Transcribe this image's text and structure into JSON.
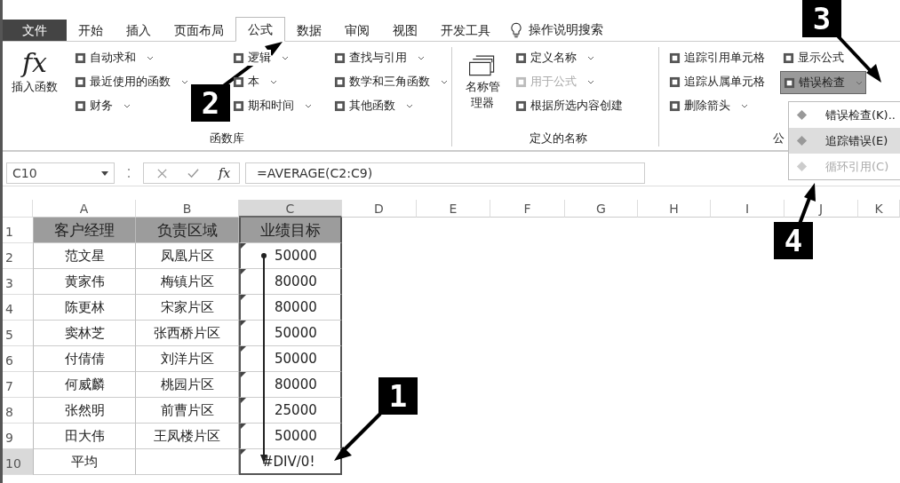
{
  "tabs": [
    {
      "label": "文件",
      "kind": "file",
      "selected": false
    },
    {
      "label": "开始",
      "kind": "tab",
      "selected": false
    },
    {
      "label": "插入",
      "kind": "tab",
      "selected": false
    },
    {
      "label": "页面布局",
      "kind": "tab",
      "selected": false
    },
    {
      "label": "公式",
      "kind": "tab",
      "selected": true
    },
    {
      "label": "数据",
      "kind": "tab",
      "selected": false
    },
    {
      "label": "审阅",
      "kind": "tab",
      "selected": false
    },
    {
      "label": "视图",
      "kind": "tab",
      "selected": false
    },
    {
      "label": "开发工具",
      "kind": "tab",
      "selected": false
    }
  ],
  "tell_me": "操作说明搜索",
  "ribbon": {
    "groups": [
      {
        "label": "函数库",
        "big_button": {
          "icon_text": "fx",
          "label": "插入函数"
        },
        "columns": [
          [
            {
              "label": "自动求和",
              "dropdown": true,
              "disabled": false,
              "selected": false
            },
            {
              "label": "最近使用的函数",
              "dropdown": true,
              "disabled": false,
              "selected": false
            },
            {
              "label": "财务",
              "dropdown": true,
              "disabled": false,
              "selected": false
            }
          ],
          [
            {
              "label": "逻辑",
              "dropdown": true,
              "disabled": false,
              "selected": false
            },
            {
              "label": "本",
              "dropdown": true,
              "disabled": false,
              "selected": false
            },
            {
              "label": "期和时间",
              "dropdown": true,
              "disabled": false,
              "selected": false
            }
          ],
          [
            {
              "label": "查找与引用",
              "dropdown": true,
              "disabled": false,
              "selected": false
            },
            {
              "label": "数学和三角函数",
              "dropdown": true,
              "disabled": false,
              "selected": false
            },
            {
              "label": "其他函数",
              "dropdown": true,
              "disabled": false,
              "selected": false
            }
          ]
        ]
      },
      {
        "label": "定义的名称",
        "big_button": {
          "label": "名称管理器"
        },
        "columns": [
          [
            {
              "label": "定义名称",
              "dropdown": true,
              "disabled": false,
              "selected": false
            },
            {
              "label": "用于公式",
              "dropdown": true,
              "disabled": true,
              "selected": false
            },
            {
              "label": "根据所选内容创建",
              "dropdown": false,
              "disabled": false,
              "selected": false
            }
          ]
        ]
      },
      {
        "label": "公",
        "columns": [
          [
            {
              "label": "追踪引用单元格",
              "dropdown": false,
              "disabled": false,
              "selected": false
            },
            {
              "label": "追踪从属单元格",
              "dropdown": false,
              "disabled": false,
              "selected": false
            },
            {
              "label": "删除箭头",
              "dropdown": true,
              "disabled": false,
              "selected": false
            }
          ],
          [
            {
              "label": "显示公式",
              "dropdown": false,
              "disabled": false,
              "selected": false
            },
            {
              "label": "错误检查",
              "dropdown": true,
              "disabled": false,
              "selected": true
            }
          ]
        ]
      }
    ]
  },
  "dropdown_menu": [
    {
      "label": "错误检查(K)..",
      "selected": false,
      "disabled": false
    },
    {
      "label": "追踪错误(E)",
      "selected": true,
      "disabled": false
    },
    {
      "label": "循环引用(C)",
      "selected": false,
      "disabled": true
    }
  ],
  "formula_bar": {
    "name_box": "C10",
    "fx": "fx",
    "formula": "=AVERAGE(C2:C9)"
  },
  "sheet": {
    "columns": [
      {
        "label": "A",
        "selected": false
      },
      {
        "label": "B",
        "selected": false
      },
      {
        "label": "C",
        "selected": true
      },
      {
        "label": "D",
        "selected": false
      },
      {
        "label": "E",
        "selected": false
      },
      {
        "label": "F",
        "selected": false
      },
      {
        "label": "G",
        "selected": false
      },
      {
        "label": "H",
        "selected": false
      },
      {
        "label": "I",
        "selected": false
      },
      {
        "label": "J",
        "selected": false
      },
      {
        "label": "K",
        "selected": false
      }
    ],
    "rows": [
      {
        "number": "1",
        "selected": false,
        "kind": "header",
        "cells": [
          "客户经理",
          "负责区域",
          "业绩目标"
        ],
        "flag": false
      },
      {
        "number": "2",
        "selected": false,
        "kind": "data",
        "cells": [
          "范文星",
          "凤凰片区",
          "50000"
        ],
        "flag": true
      },
      {
        "number": "3",
        "selected": false,
        "kind": "data",
        "cells": [
          "黄家伟",
          "梅镇片区",
          "80000"
        ],
        "flag": true
      },
      {
        "number": "4",
        "selected": false,
        "kind": "data",
        "cells": [
          "陈更林",
          "宋家片区",
          "80000"
        ],
        "flag": true
      },
      {
        "number": "5",
        "selected": false,
        "kind": "data",
        "cells": [
          "窦林芝",
          "张西桥片区",
          "50000"
        ],
        "flag": true
      },
      {
        "number": "6",
        "selected": false,
        "kind": "data",
        "cells": [
          "付倩倩",
          "刘洋片区",
          "50000"
        ],
        "flag": true
      },
      {
        "number": "7",
        "selected": false,
        "kind": "data",
        "cells": [
          "何威麟",
          "桃园片区",
          "80000"
        ],
        "flag": true
      },
      {
        "number": "8",
        "selected": false,
        "kind": "data",
        "cells": [
          "张然明",
          "前曹片区",
          "25000"
        ],
        "flag": true
      },
      {
        "number": "9",
        "selected": false,
        "kind": "data",
        "cells": [
          "田大伟",
          "王凤楼片区",
          "50000"
        ],
        "flag": true
      },
      {
        "number": "10",
        "selected": true,
        "kind": "total",
        "cells": [
          "平均",
          "",
          "#DIV/0!"
        ],
        "flag": true
      }
    ]
  },
  "callouts": [
    "1",
    "2",
    "3",
    "4"
  ]
}
